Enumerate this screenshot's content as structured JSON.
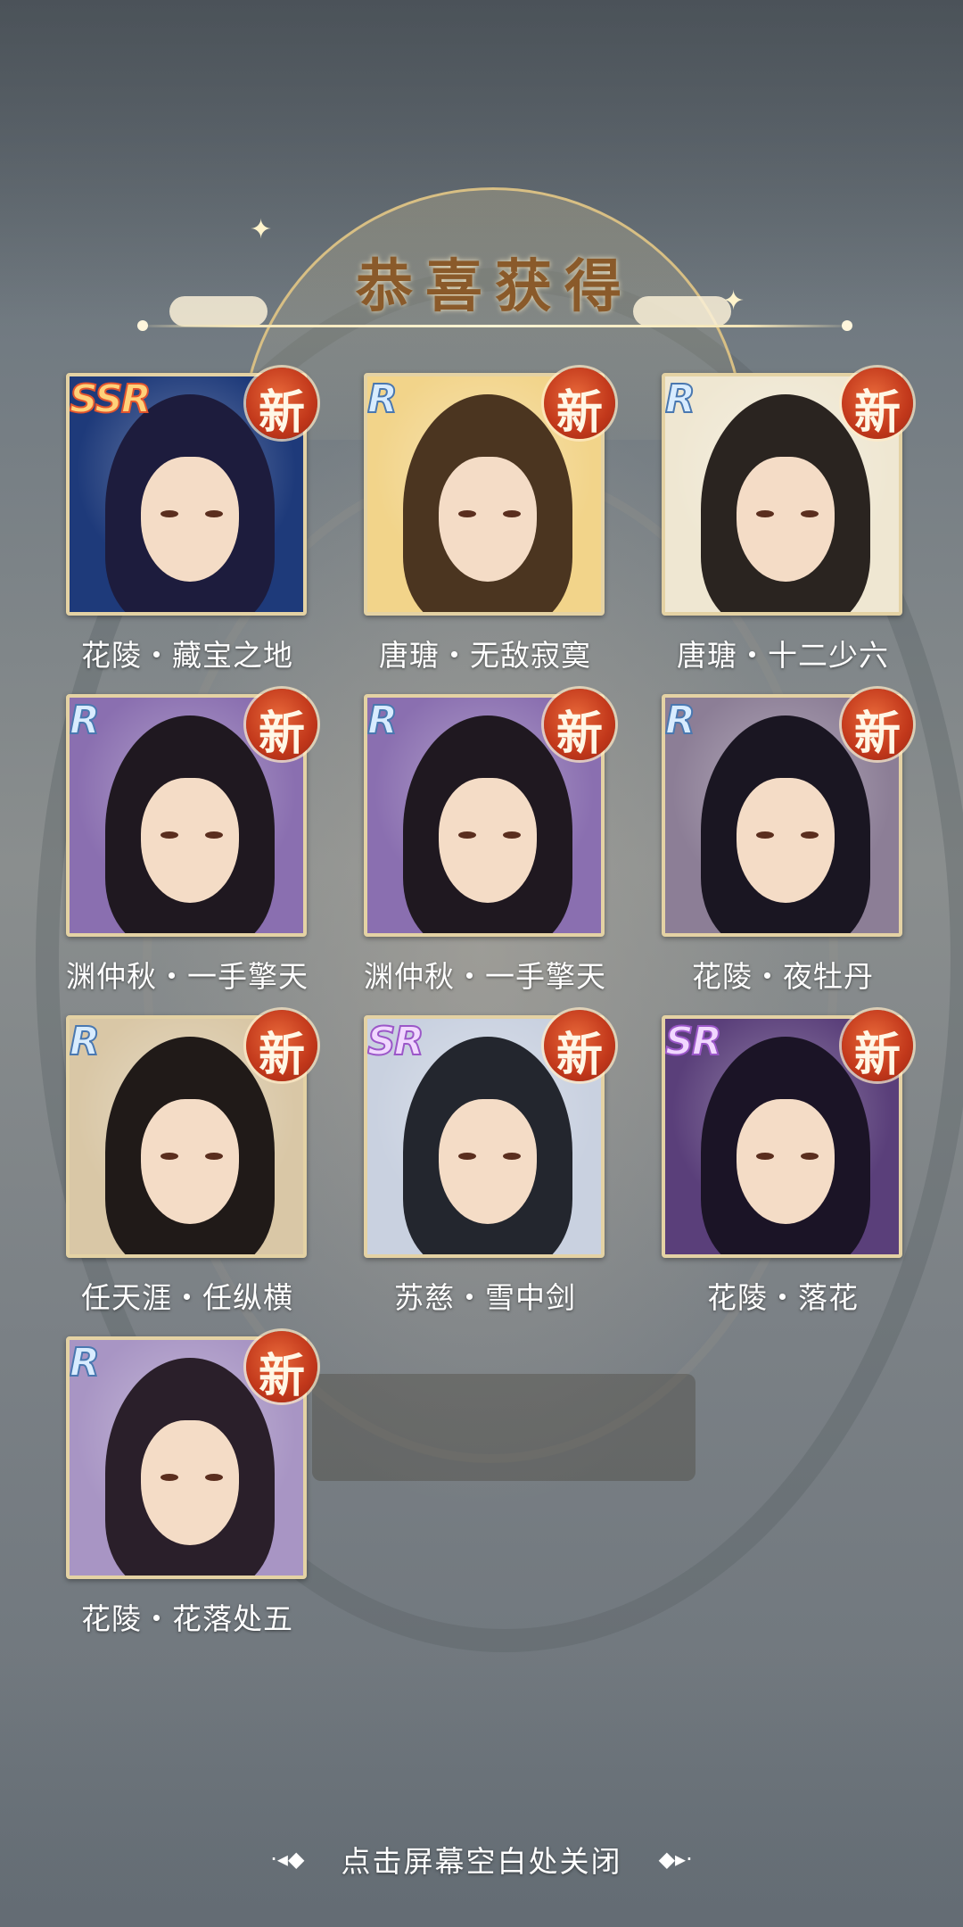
{
  "header": {
    "title": "恭喜获得"
  },
  "characters": [
    {
      "name": "花陵・藏宝之地",
      "rarity": "SSR",
      "new_label": "新",
      "hair": "#1d1c3d",
      "bg": "#1e3a7a"
    },
    {
      "name": "唐瑭・无敌寂寞",
      "rarity": "R",
      "new_label": "新",
      "hair": "#4b3520",
      "bg": "#f2d48a"
    },
    {
      "name": "唐瑭・十二少六",
      "rarity": "R",
      "new_label": "新",
      "hair": "#2a2420",
      "bg": "#efe7d2"
    },
    {
      "name": "渊仲秋・一手擎天",
      "rarity": "R",
      "new_label": "新",
      "hair": "#1f1820",
      "bg": "#8a6fb0"
    },
    {
      "name": "渊仲秋・一手擎天",
      "rarity": "R",
      "new_label": "新",
      "hair": "#1f1820",
      "bg": "#8a6fb0"
    },
    {
      "name": "花陵・夜牡丹",
      "rarity": "R",
      "new_label": "新",
      "hair": "#1a1622",
      "bg": "#8c7e96"
    },
    {
      "name": "任天涯・任纵横",
      "rarity": "R",
      "new_label": "新",
      "hair": "#201a18",
      "bg": "#d9c7a6"
    },
    {
      "name": "苏慈・雪中剑",
      "rarity": "SR",
      "new_label": "新",
      "hair": "#23262e",
      "bg": "#c9d1e0"
    },
    {
      "name": "花陵・落花",
      "rarity": "SR",
      "new_label": "新",
      "hair": "#1b1426",
      "bg": "#5a3f7a"
    },
    {
      "name": "花陵・花落处五",
      "rarity": "R",
      "new_label": "新",
      "hair": "#2a1f2a",
      "bg": "#a895c4"
    }
  ],
  "footer": {
    "hint": "点击屏幕空白处关闭",
    "deco_left": "·◂◆",
    "deco_right": "◆▸·"
  }
}
